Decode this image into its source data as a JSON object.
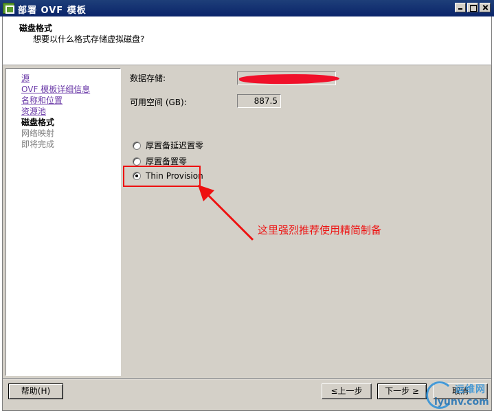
{
  "window": {
    "title": "部署 OVF 模板",
    "app_icon": "vsphere-deploy-icon"
  },
  "header": {
    "title": "磁盘格式",
    "subtitle": "想要以什么格式存储虚拟磁盘?"
  },
  "nav": {
    "items": [
      {
        "label": "源",
        "state": "link"
      },
      {
        "label": "OVF 模板详细信息",
        "state": "link"
      },
      {
        "label": "名称和位置",
        "state": "link"
      },
      {
        "label": "资源池",
        "state": "link"
      },
      {
        "label": "磁盘格式",
        "state": "current"
      },
      {
        "label": "网络映射",
        "state": "disabled"
      },
      {
        "label": "即将完成",
        "state": "disabled"
      }
    ]
  },
  "form": {
    "datastore_label": "数据存储:",
    "datastore_value_redacted": true,
    "free_space_label": "可用空间 (GB):",
    "free_space_value": "887.5",
    "disk_formats": [
      {
        "label": "厚置备延迟置零",
        "selected": false
      },
      {
        "label": "厚置备置零",
        "selected": false
      },
      {
        "label": "Thin Provision",
        "selected": true
      }
    ]
  },
  "annotation": {
    "text": "这里强烈推荐使用精简制备",
    "color": "#ee1010"
  },
  "buttons": {
    "help": "帮助(H)",
    "back": "≤上一步",
    "next": "下一步 ≥",
    "cancel": "取消"
  },
  "watermark": {
    "cn": "运维网",
    "en": "iyunv.com"
  }
}
